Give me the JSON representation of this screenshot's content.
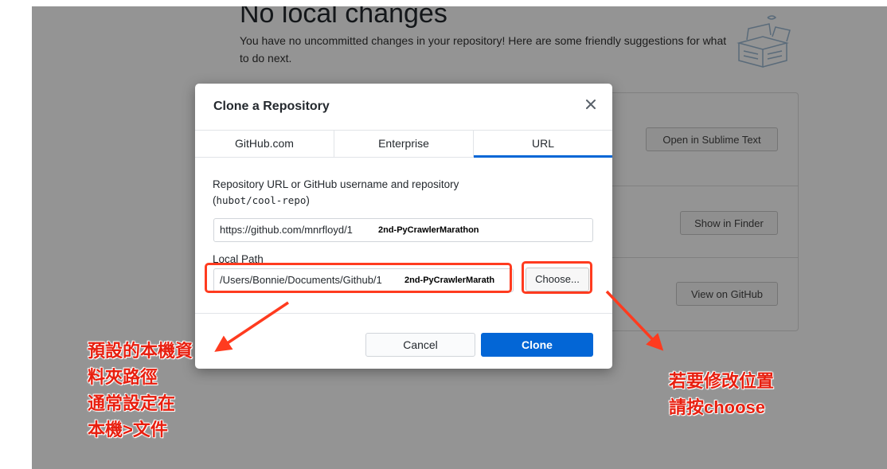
{
  "background": {
    "title": "No local changes",
    "description": "You have no uncommitted changes in your repository! Here are some friendly suggestions for what to do next.",
    "buttons": {
      "open_editor": "Open in Sublime Text",
      "show_finder": "Show in Finder",
      "view_github": "View on GitHub"
    }
  },
  "dialog": {
    "title": "Clone a Repository",
    "tabs": [
      {
        "label": "GitHub.com",
        "active": false
      },
      {
        "label": "Enterprise",
        "active": false
      },
      {
        "label": "URL",
        "active": true
      }
    ],
    "url_label": "Repository URL or GitHub username and repository",
    "url_hint_open": "(",
    "url_hint_code": "hubot/cool-repo",
    "url_hint_close": ")",
    "url_value": "https://github.com/mnrfloyd/1",
    "url_value_mask": "2nd-PyCrawlerMarathon",
    "local_path_label": "Local Path",
    "local_path_value": "/Users/Bonnie/Documents/Github/1",
    "local_path_mask": "2nd-PyCrawlerMarath",
    "choose_label": "Choose...",
    "cancel_label": "Cancel",
    "clone_label": "Clone"
  },
  "annotations": {
    "left_note": "預設的本機資\n料夾路徑\n通常設定在\n本機>文件",
    "right_note": "若要修改位置\n請按choose"
  },
  "colors": {
    "accent": "#0366d6",
    "annotation_red": "#e81f0f",
    "overlay": "rgba(0,0,0,0.42)"
  }
}
